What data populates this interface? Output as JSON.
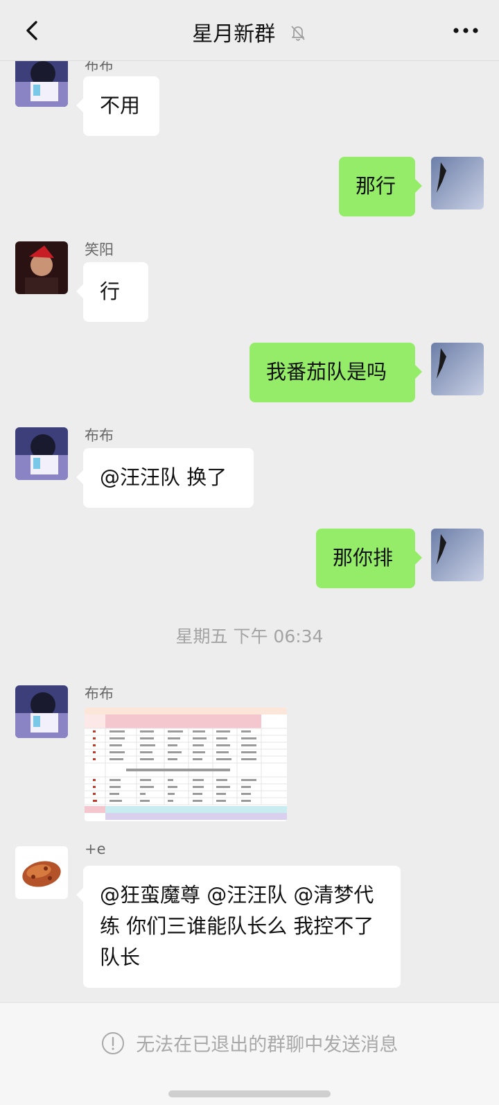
{
  "header": {
    "title": "星月新群"
  },
  "messages": {
    "m1": {
      "sender": "布布",
      "text": "不用"
    },
    "m2": {
      "text": "那行"
    },
    "m3": {
      "sender": "笑阳",
      "text": "行"
    },
    "m4": {
      "text": "我番茄队是吗"
    },
    "m5": {
      "sender": "布布",
      "text": "@汪汪队 换了"
    },
    "m6": {
      "text": "那你排"
    },
    "timestamp": "星期五 下午 06:34",
    "m7": {
      "sender": "布布"
    },
    "m8": {
      "sender": "+e",
      "text": "@狂蛮魔尊 @汪汪队 @清梦代练 你们三谁能队长么  我控不了队长"
    }
  },
  "footer": {
    "notice": "无法在已退出的群聊中发送消息"
  },
  "colors": {
    "bubble_out": "#95ec69",
    "bubble_in": "#ffffff",
    "background": "#ededed"
  }
}
